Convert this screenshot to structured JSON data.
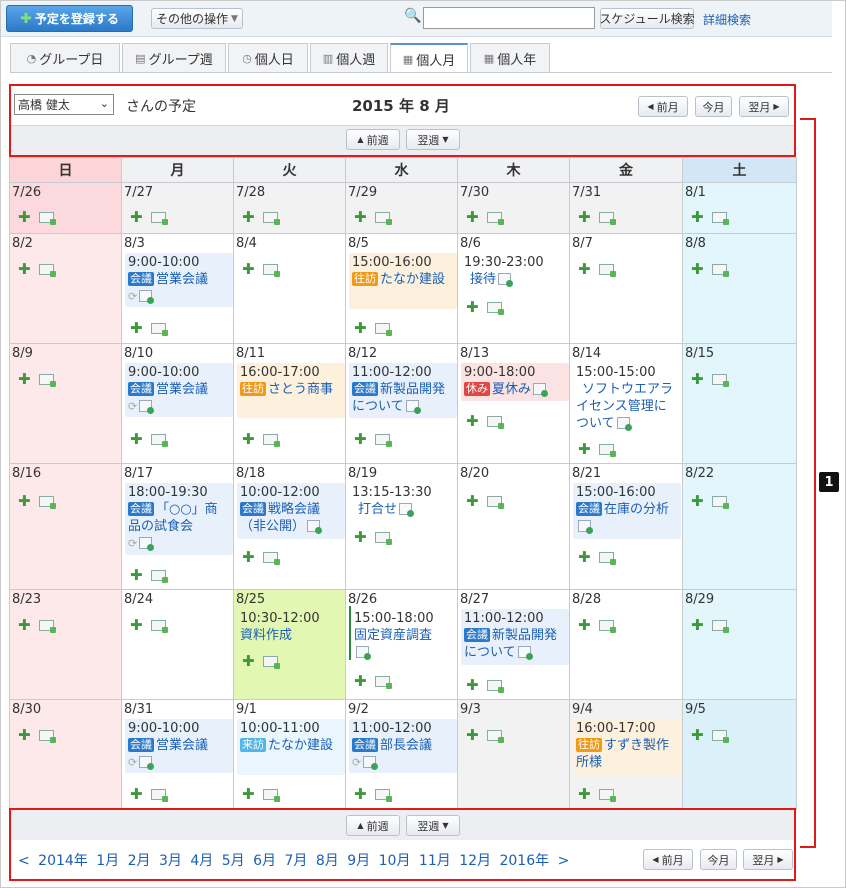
{
  "toolbar": {
    "add_label": "予定を登録する",
    "other_label": "その他の操作",
    "search_value": "",
    "search_button": "スケジュール検索",
    "advanced_search": "詳細検索"
  },
  "tabs": [
    {
      "label": "グループ日",
      "icon": "group-day-icon"
    },
    {
      "label": "グループ週",
      "icon": "group-week-icon"
    },
    {
      "label": "個人日",
      "icon": "clock-icon"
    },
    {
      "label": "個人週",
      "icon": "person-week-icon"
    },
    {
      "label": "個人月",
      "icon": "calendar-month-icon",
      "active": true
    },
    {
      "label": "個人年",
      "icon": "calendar-year-icon"
    }
  ],
  "header": {
    "user": "高橋 健太",
    "schedule_of": "さんの予定",
    "month_title": "2015 年 8 月",
    "prev_month": "前月",
    "this_month": "今月",
    "next_month": "翌月",
    "prev_week": "前週",
    "next_week": "翌週"
  },
  "weekdays": [
    "日",
    "月",
    "火",
    "水",
    "木",
    "金",
    "土"
  ],
  "weeks": [
    {
      "dates": [
        "7/26",
        "7/27",
        "7/28",
        "7/29",
        "7/30",
        "7/31",
        "8/1"
      ]
    },
    {
      "dates": [
        "8/2",
        "8/3",
        "8/4",
        "8/5",
        "8/6",
        "8/7",
        "8/8"
      ]
    },
    {
      "dates": [
        "8/9",
        "8/10",
        "8/11",
        "8/12",
        "8/13",
        "8/14",
        "8/15"
      ]
    },
    {
      "dates": [
        "8/16",
        "8/17",
        "8/18",
        "8/19",
        "8/20",
        "8/21",
        "8/22"
      ]
    },
    {
      "dates": [
        "8/23",
        "8/24",
        "8/25",
        "8/26",
        "8/27",
        "8/28",
        "8/29"
      ]
    },
    {
      "dates": [
        "8/30",
        "8/31",
        "9/1",
        "9/2",
        "9/3",
        "9/4",
        "9/5"
      ]
    }
  ],
  "events": {
    "w1": {
      "mon": {
        "time": "9:00-10:00",
        "badge": "会議",
        "title": "営業会議"
      },
      "wed": {
        "time": "15:00-16:00",
        "badge": "往訪",
        "title": "たなか建設"
      },
      "thu": {
        "time": "19:30-23:00",
        "title": "接待"
      }
    },
    "w2": {
      "mon": {
        "time": "9:00-10:00",
        "badge": "会議",
        "title": "営業会議"
      },
      "tue": {
        "time": "16:00-17:00",
        "badge": "往訪",
        "title": "さとう商事"
      },
      "wed": {
        "time": "11:00-12:00",
        "badge": "会議",
        "title": "新製品開発について"
      },
      "thu": {
        "time": "9:00-18:00",
        "badge": "休み",
        "title": "夏休み"
      },
      "fri": {
        "time": "15:00-15:00",
        "title": "ソフトウエアライセンス管理について"
      }
    },
    "w3": {
      "mon": {
        "time": "18:00-19:30",
        "badge": "会議",
        "title": "「○○」商品の試食会"
      },
      "tue": {
        "time": "10:00-12:00",
        "badge": "会議",
        "title": "戦略会議（非公開）"
      },
      "wed": {
        "time": "13:15-13:30",
        "title": "打合せ"
      },
      "fri": {
        "time": "15:00-16:00",
        "badge": "会議",
        "title": "在庫の分析"
      }
    },
    "w4": {
      "tue": {
        "time": "10:30-12:00",
        "title": "資料作成"
      },
      "wed": {
        "time": "15:00-18:00",
        "title": "固定資産調査"
      },
      "thu": {
        "time": "11:00-12:00",
        "badge": "会議",
        "title": "新製品開発について"
      }
    },
    "w5": {
      "mon": {
        "time": "9:00-10:00",
        "badge": "会議",
        "title": "営業会議"
      },
      "tue": {
        "time": "10:00-11:00",
        "badge": "来訪",
        "title": "たなか建設"
      },
      "wed": {
        "time": "11:00-12:00",
        "badge": "会議",
        "title": "部長会議"
      },
      "fri": {
        "time": "16:00-17:00",
        "badge": "往訪",
        "title": "すずき製作所様"
      }
    }
  },
  "year_nav": {
    "prev": "< 2014年",
    "months": [
      "1月",
      "2月",
      "3月",
      "4月",
      "5月",
      "6月",
      "7月",
      "8月",
      "9月",
      "10月",
      "11月",
      "12月"
    ],
    "next": "2016年 >"
  },
  "callout": "1",
  "colors": {
    "accent": "#2b79c8",
    "annotation": "#e01919",
    "sunday": "#fde8ea",
    "saturday": "#e3f6fb",
    "today": "#e2f7b2"
  }
}
